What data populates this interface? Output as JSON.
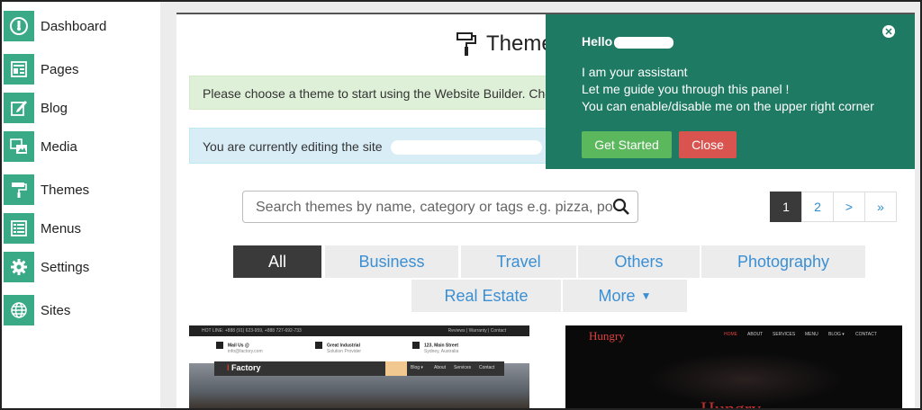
{
  "sidebar": {
    "items": [
      {
        "label": "Dashboard",
        "icon": "dashboard-icon"
      },
      {
        "label": "Pages",
        "icon": "pages-icon"
      },
      {
        "label": "Blog",
        "icon": "blog-icon"
      },
      {
        "label": "Media",
        "icon": "media-icon"
      },
      {
        "label": "Themes",
        "icon": "paint-roller-icon"
      },
      {
        "label": "Menus",
        "icon": "menus-icon"
      },
      {
        "label": "Settings",
        "icon": "gear-icon"
      },
      {
        "label": "Sites",
        "icon": "globe-icon"
      }
    ]
  },
  "main": {
    "title": "Theme",
    "alert_success": "Please choose a theme to start using the Website Builder. Choo",
    "alert_info": "You are currently editing the site",
    "search": {
      "placeholder": "Search themes by name, category or tags e.g. pizza, po"
    },
    "pagination": {
      "pages": [
        "1",
        "2",
        ">",
        "»"
      ],
      "active": "1"
    },
    "tabs": [
      {
        "label": "All",
        "active": true
      },
      {
        "label": "Business"
      },
      {
        "label": "Travel"
      },
      {
        "label": "Others"
      },
      {
        "label": "Photography"
      },
      {
        "label": "Real Estate"
      },
      {
        "label": "More"
      }
    ]
  },
  "assistant": {
    "hello": "Hello",
    "line1": "I am your assistant",
    "line2": "Let me guide you through this panel !",
    "line3": "You can enable/disable me on the upper right corner",
    "get_started": "Get Started",
    "close": "Close"
  },
  "thumb_left": {
    "topbar": "HOT LINE: +888 (91) 623-959, +888 727-692-733",
    "toplinks": "Reviews | Warranty | Contact",
    "info1_title": "Mail Us @",
    "info1_sub": "info@factory.com",
    "info2_title": "Great Industrial",
    "info2_sub": "Solution Provider",
    "info3_title": "123, Main Street",
    "info3_sub": "Sydney, Australia",
    "logo": "Factory",
    "nav": [
      "Blog ▾",
      "About",
      "Services",
      "Contact"
    ]
  },
  "thumb_right": {
    "logo": "Hungry",
    "nav": [
      "HOME",
      "ABOUT",
      "SERVICES",
      "MENU",
      "BLOG ▾",
      "CONTACT"
    ],
    "hero": "Hungry"
  },
  "colors": {
    "accent": "#3aa985",
    "assistant_bg": "#1e7a62",
    "get_started": "#5cb85c",
    "close": "#d9534f",
    "link": "#3a8fd4"
  }
}
